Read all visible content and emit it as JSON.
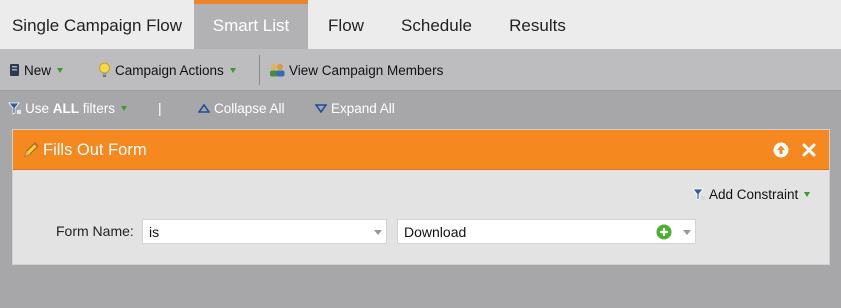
{
  "tabs": [
    {
      "label": "Single Campaign Flow",
      "active": false
    },
    {
      "label": "Smart List",
      "active": true
    },
    {
      "label": "Flow",
      "active": false
    },
    {
      "label": "Schedule",
      "active": false
    },
    {
      "label": "Results",
      "active": false
    }
  ],
  "toolbar": {
    "new_label": "New",
    "campaign_actions_label": "Campaign Actions",
    "view_members_label": "View Campaign Members"
  },
  "filterbar": {
    "use_prefix": "Use",
    "use_emphasis": "ALL",
    "use_suffix": "filters",
    "separator": "|",
    "collapse_label": "Collapse All",
    "expand_label": "Expand All"
  },
  "filter": {
    "title": "Fills Out Form",
    "add_constraint_label": "Add Constraint",
    "field_label": "Form Name:",
    "operator_value": "is",
    "form_value": "Download"
  },
  "colors": {
    "accent_orange": "#f5881f",
    "green_caret": "#3d9a2d",
    "add_green": "#4caf2f"
  },
  "icons": [
    "new-document-icon",
    "lightbulb-icon",
    "campaign-members-icon",
    "filter-funnel-icon",
    "collapse-triangle-icon",
    "expand-triangle-icon",
    "pencil-icon",
    "move-up-icon",
    "close-icon",
    "add-icon"
  ]
}
